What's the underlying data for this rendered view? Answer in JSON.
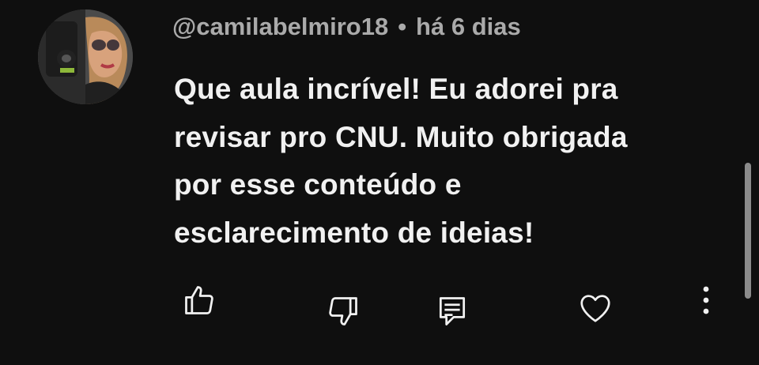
{
  "comment": {
    "author": "@camilabelmiro18",
    "separator": "•",
    "time": "há 6 dias",
    "text_lines": [
      "Que aula incrível! Eu adorei pra",
      "revisar pro CNU. Muito obrigada",
      "por esse conteúdo e",
      "esclarecimento de ideias!"
    ]
  },
  "actions": {
    "like_icon": "thumbs-up-icon",
    "dislike_icon": "thumbs-down-icon",
    "reply_icon": "comment-reply-icon",
    "heart_icon": "heart-icon",
    "more_icon": "more-vertical-icon"
  },
  "colors": {
    "background": "#0f0f0f",
    "text": "#f1f1f1",
    "meta_text": "#aaaaaa",
    "scrollbar": "#8b8b8b"
  }
}
